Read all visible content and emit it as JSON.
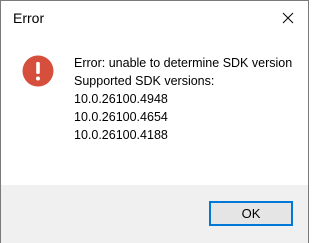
{
  "window": {
    "title": "Error"
  },
  "message": {
    "lines": [
      "Error: unable to determine SDK version",
      "Supported SDK versions:",
      "10.0.26100.4948",
      "10.0.26100.4654",
      "10.0.26100.4188"
    ]
  },
  "buttons": {
    "ok_label": "OK",
    "close_icon": "close-icon"
  },
  "icons": {
    "error": "error-icon"
  },
  "colors": {
    "error_icon": "#d64f3c",
    "button_focus_border": "#0078d7",
    "footer_background": "#f0f0f0"
  }
}
